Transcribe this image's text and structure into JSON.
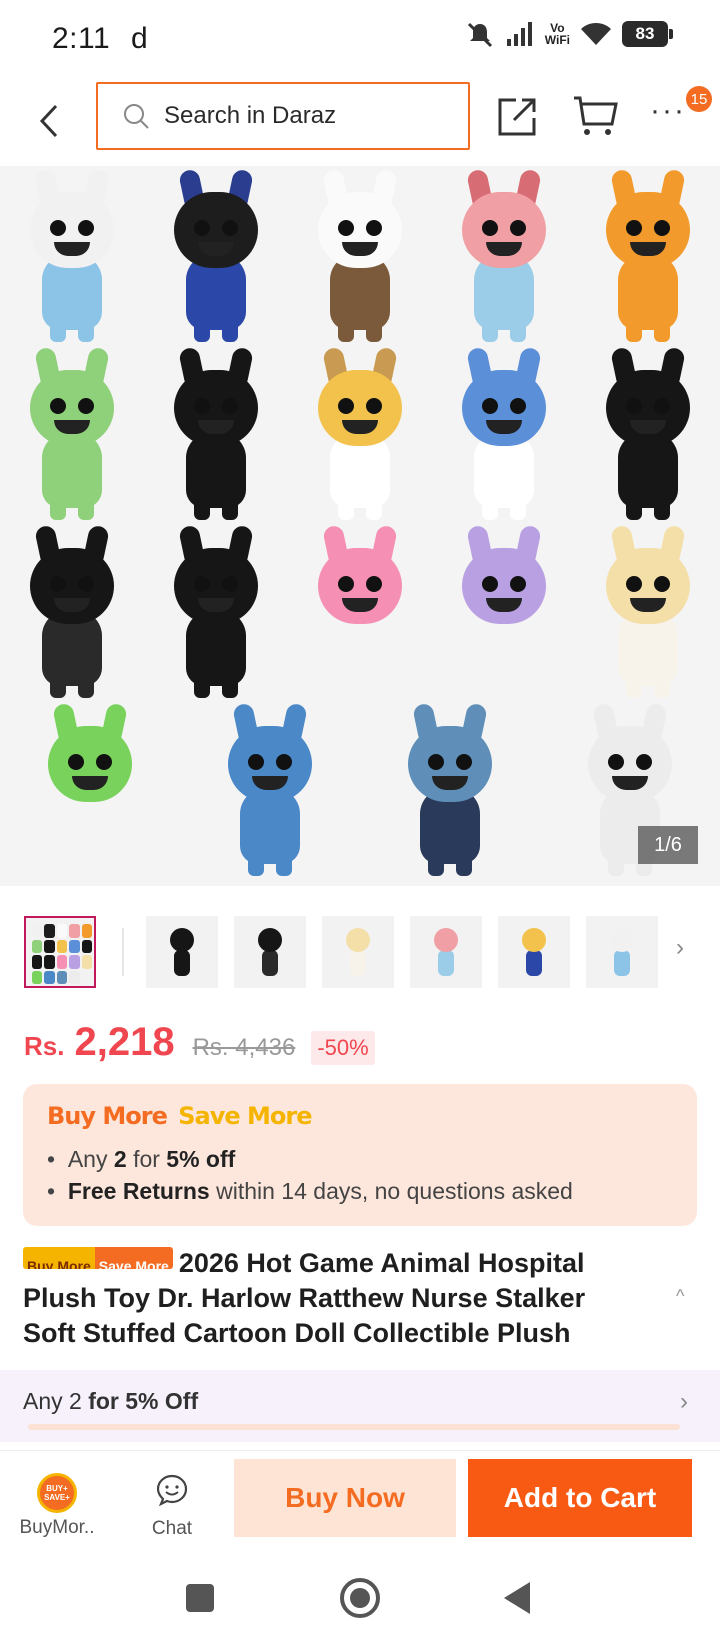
{
  "status_bar": {
    "time": "2:11",
    "notification_letter": "d",
    "network_label_top": "Vo",
    "network_label_bottom": "WiFi",
    "battery": "83"
  },
  "top_nav": {
    "search_placeholder": "Search in Daraz",
    "more_label": "···",
    "cart_badge": "15"
  },
  "gallery": {
    "counter": "1/6",
    "plushies": [
      {
        "head": "#f1f1f1",
        "body": "#8cc4e8",
        "ears": "#f1f1f1"
      },
      {
        "head": "#1d1d1d",
        "body": "#2b47a8",
        "ears": "#2b3d8f"
      },
      {
        "head": "#fafafa",
        "body": "#7a5a3a",
        "ears": "#fafafa"
      },
      {
        "head": "#f0a0a4",
        "body": "#9ccde8",
        "ears": "#d86c74"
      },
      {
        "head": "#f39a2c",
        "body": "#f39a2c",
        "ears": "#f39a2c"
      },
      {
        "head": "#8fd07a",
        "body": "#8fd07a",
        "ears": "#8fd07a"
      },
      {
        "head": "#161616",
        "body": "#161616",
        "ears": "#161616"
      },
      {
        "head": "#f2c24c",
        "body": "#ffffff",
        "ears": "#c89a52"
      },
      {
        "head": "#5b8fd8",
        "body": "#ffffff",
        "ears": "#5b8fd8"
      },
      {
        "head": "#161616",
        "body": "#161616",
        "ears": "#161616"
      },
      {
        "head": "#161616",
        "body": "#2a2a2a",
        "ears": "#161616"
      },
      {
        "head": "#161616",
        "body": "#161616",
        "ears": "#161616"
      },
      {
        "head": "#f58fb3",
        "body": "#f4f4f4",
        "ears": "#f58fb3"
      },
      {
        "head": "#b9a0e2",
        "body": "#f4f4f4",
        "ears": "#b9a0e2"
      },
      {
        "head": "#f4dfa8",
        "body": "#f7f3ea",
        "ears": "#f4dfa8"
      },
      {
        "head": "#78d25c",
        "body": "#f4f4f4",
        "ears": "#78d25c"
      },
      {
        "head": "#4a88c8",
        "body": "#4a88c8",
        "ears": "#4a88c8"
      },
      {
        "head": "#5f8fb8",
        "body": "#2a3a5a",
        "ears": "#5f8fb8"
      },
      {
        "head": "#ececec",
        "body": "#ececec",
        "ears": "#ececec"
      }
    ]
  },
  "thumbnails": {
    "next_label": "›",
    "items": [
      {
        "head": "#161616",
        "body": "#161616"
      },
      {
        "head": "#161616",
        "body": "#2a2a2a"
      },
      {
        "head": "#f4dfa8",
        "body": "#f7f3ea"
      },
      {
        "head": "#f0a0a4",
        "body": "#9ccde8"
      },
      {
        "head": "#f2c24c",
        "body": "#2b47a8"
      },
      {
        "head": "#f1f1f1",
        "body": "#8cc4e8"
      }
    ]
  },
  "price": {
    "currency": "Rs.",
    "value": "2,218",
    "original": "Rs. 4,436",
    "discount": "-50%"
  },
  "promo": {
    "title_buy": "Buy More",
    "title_save": "Save More",
    "line1_prefix": "Any",
    "line1_count": "2",
    "line1_middle": "for",
    "line1_offer": "5% off",
    "line2_bold": "Free Returns",
    "line2_rest": "within 14 days, no questions asked"
  },
  "product": {
    "badge_buy": "Buy More",
    "badge_save": "Save More",
    "title": "2026 Hot Game Animal Hospital Plush Toy Dr. Harlow Ratthew Nurse Stalker Soft Stuffed Cartoon Doll Collectible Plush",
    "collapse_label": "^"
  },
  "bundle": {
    "prefix": "Any 2",
    "offer": "for 5% Off",
    "chevron": "›"
  },
  "action_bar": {
    "buymore_label": "BuyMor..",
    "buymore_icon_text_top": "BUY+",
    "buymore_icon_text_bottom": "SAVE+",
    "chat_label": "Chat",
    "buy_now_label": "Buy Now",
    "add_to_cart_label": "Add to Cart"
  },
  "colors": {
    "accent": "#f36c21",
    "price": "#f0464f",
    "add_to_cart": "#f85a14"
  }
}
